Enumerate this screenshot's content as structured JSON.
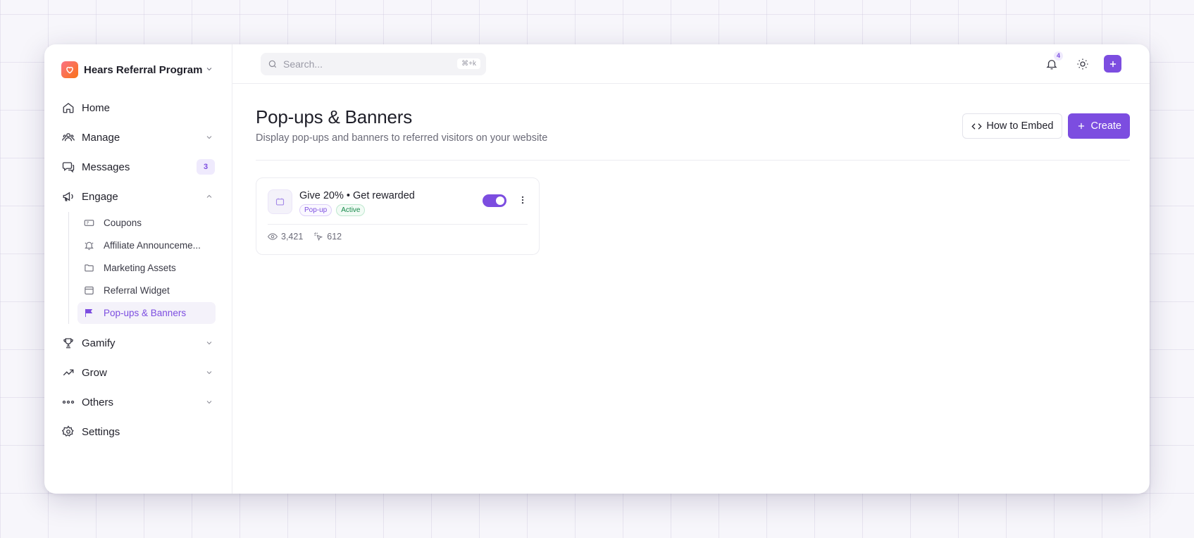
{
  "brand": {
    "name": "Hears Referral Program"
  },
  "sidebar": {
    "items": [
      {
        "label": "Home"
      },
      {
        "label": "Manage"
      },
      {
        "label": "Messages",
        "badge": "3"
      },
      {
        "label": "Engage"
      },
      {
        "label": "Gamify"
      },
      {
        "label": "Grow"
      },
      {
        "label": "Others"
      },
      {
        "label": "Settings"
      }
    ],
    "engage_sub": [
      {
        "label": "Coupons"
      },
      {
        "label": "Affiliate Announceme..."
      },
      {
        "label": "Marketing Assets"
      },
      {
        "label": "Referral Widget"
      },
      {
        "label": "Pop-ups & Banners"
      }
    ]
  },
  "topbar": {
    "search_placeholder": "Search...",
    "search_shortcut": "⌘+k",
    "notification_count": "4"
  },
  "page": {
    "title": "Pop-ups & Banners",
    "subtitle": "Display pop-ups and banners to referred visitors on your website",
    "embed_label": "How to Embed",
    "create_label": "Create"
  },
  "cards": [
    {
      "title": "Give 20% • Get rewarded",
      "type_tag": "Pop-up",
      "status_tag": "Active",
      "enabled": true,
      "views": "3,421",
      "clicks": "612"
    }
  ],
  "colors": {
    "accent": "#7c4de0",
    "active_green": "#16894a"
  }
}
